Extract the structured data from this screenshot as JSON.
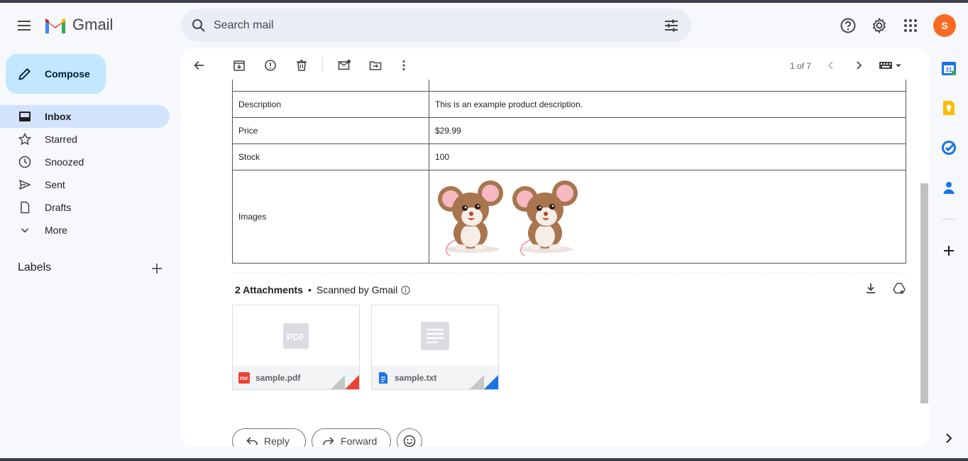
{
  "app": {
    "name": "Gmail"
  },
  "search": {
    "placeholder": "Search mail"
  },
  "user": {
    "initial": "S",
    "avatar_color": "#fa6b22"
  },
  "compose": {
    "label": "Compose"
  },
  "nav": {
    "items": [
      {
        "label": "Inbox",
        "icon": "inbox-icon",
        "active": true
      },
      {
        "label": "Starred",
        "icon": "star-icon"
      },
      {
        "label": "Snoozed",
        "icon": "clock-icon"
      },
      {
        "label": "Sent",
        "icon": "send-icon"
      },
      {
        "label": "Drafts",
        "icon": "draft-icon"
      },
      {
        "label": "More",
        "icon": "chevron-down-icon"
      }
    ]
  },
  "labels": {
    "title": "Labels"
  },
  "toolbar": {
    "pager": "1 of 7"
  },
  "product_table": {
    "rows": [
      {
        "key": "Description",
        "value": "This is an example product description."
      },
      {
        "key": "Price",
        "value": "$29.99"
      },
      {
        "key": "Stock",
        "value": "100"
      },
      {
        "key": "Images",
        "value": ""
      }
    ]
  },
  "attachments": {
    "count_label": "2 Attachments",
    "scanned_label": "Scanned by Gmail",
    "files": [
      {
        "name": "sample.pdf",
        "type": "pdf",
        "accent": "#ea4335"
      },
      {
        "name": "sample.txt",
        "type": "txt",
        "accent": "#1a73e8"
      }
    ]
  },
  "actions": {
    "reply": "Reply",
    "forward": "Forward"
  },
  "colors": {
    "accent": "#0b57d0",
    "compose_bg": "#c2e7ff",
    "active_nav": "#d3e3fd"
  }
}
